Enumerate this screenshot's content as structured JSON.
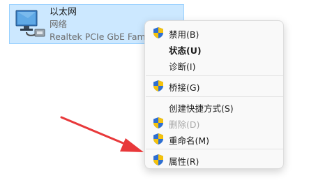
{
  "adapter": {
    "name": "以太网",
    "status": "网络",
    "device": "Realtek PCIe GbE Family Controller",
    "icon": "ethernet-adapter-icon"
  },
  "menu": {
    "items": [
      {
        "label": "禁用(B)",
        "shield": true,
        "style": "normal"
      },
      {
        "label": "状态(U)",
        "shield": false,
        "style": "bold"
      },
      {
        "label": "诊断(I)",
        "shield": false,
        "style": "normal"
      },
      {
        "label": "桥接(G)",
        "shield": true,
        "style": "normal"
      },
      {
        "label": "创建快捷方式(S)",
        "shield": false,
        "style": "normal"
      },
      {
        "label": "删除(D)",
        "shield": true,
        "style": "disabled"
      },
      {
        "label": "重命名(M)",
        "shield": true,
        "style": "normal"
      },
      {
        "label": "属性(R)",
        "shield": true,
        "style": "normal"
      }
    ]
  },
  "annotation": {
    "arrow_color": "#e8383a",
    "icon": "red-arrow-icon"
  }
}
